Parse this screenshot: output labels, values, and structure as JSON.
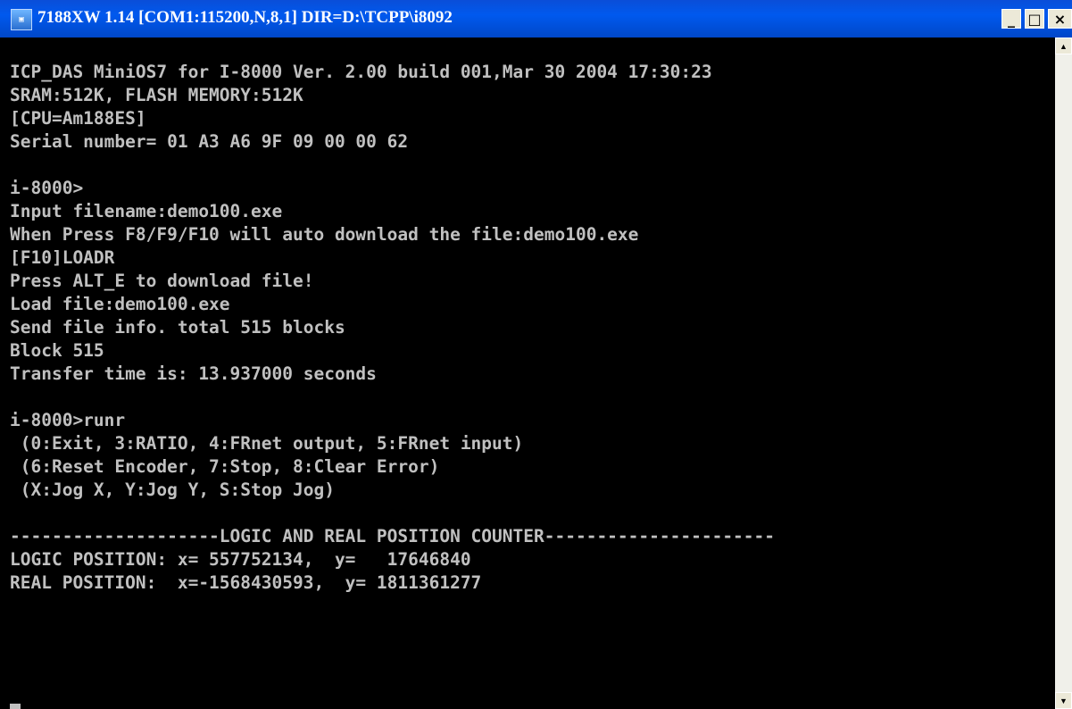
{
  "window": {
    "title": "7188XW 1.14 [COM1:115200,N,8,1] DIR=D:\\TCPP\\i8092",
    "icon": "terminal-app-icon",
    "controls": {
      "minimize": "_",
      "maximize": "□",
      "close": "×"
    }
  },
  "terminal": {
    "lines": [
      "",
      "ICP_DAS MiniOS7 for I-8000 Ver. 2.00 build 001,Mar 30 2004 17:30:23",
      "SRAM:512K, FLASH MEMORY:512K",
      "[CPU=Am188ES]",
      "Serial number= 01 A3 A6 9F 09 00 00 62",
      "",
      "i-8000>",
      "Input filename:demo100.exe",
      "When Press F8/F9/F10 will auto download the file:demo100.exe",
      "[F10]LOADR",
      "Press ALT_E to download file!",
      "Load file:demo100.exe",
      "Send file info. total 515 blocks",
      "Block 515",
      "Transfer time is: 13.937000 seconds",
      "",
      "i-8000>runr",
      " (0:Exit, 3:RATIO, 4:FRnet output, 5:FRnet input)",
      " (6:Reset Encoder, 7:Stop, 8:Clear Error)",
      " (X:Jog X, Y:Jog Y, S:Stop Jog)",
      "",
      "--------------------LOGIC AND REAL POSITION COUNTER----------------------",
      "LOGIC POSITION: x= 557752134,  y=   17646840",
      "REAL POSITION:  x=-1568430593,  y= 1811361277"
    ]
  },
  "scrollbar": {
    "up": "▲",
    "down": "▼"
  }
}
